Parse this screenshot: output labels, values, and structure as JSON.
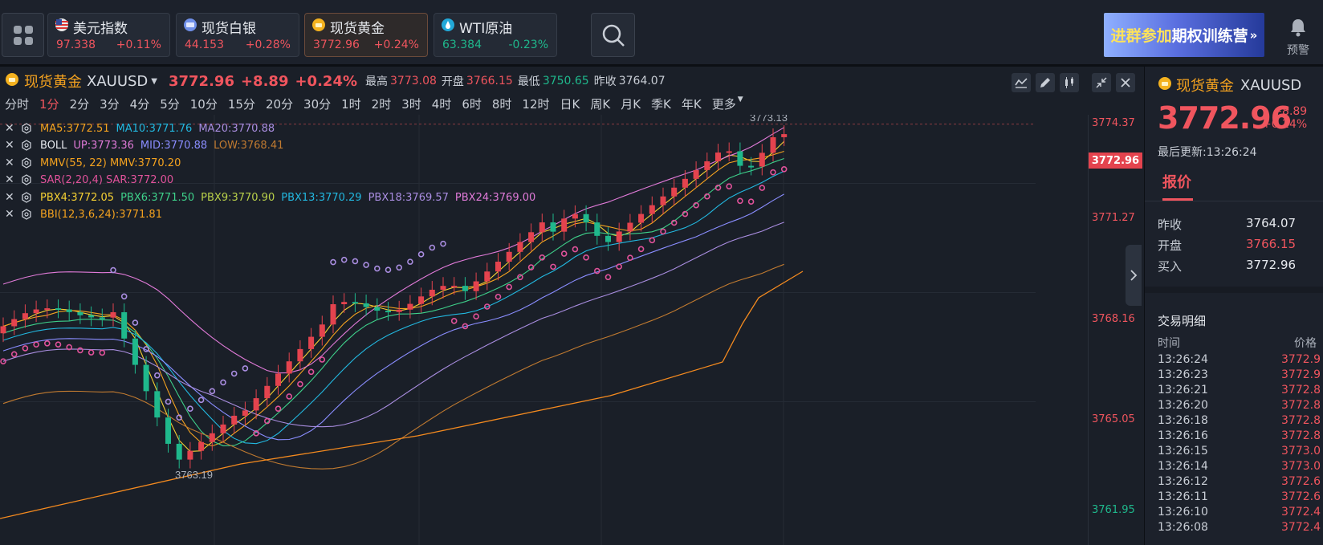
{
  "tickers": [
    {
      "name": "美元指数",
      "price": "97.338",
      "change": "+0.11%",
      "dir": "up",
      "icon": "us-flag-icon"
    },
    {
      "name": "现货白银",
      "price": "44.153",
      "change": "+0.28%",
      "dir": "up",
      "icon": "silver-coin-icon"
    },
    {
      "name": "现货黄金",
      "price": "3772.96",
      "change": "+0.24%",
      "dir": "up",
      "icon": "gold-coin-icon"
    },
    {
      "name": "WTI原油",
      "price": "63.384",
      "change": "-0.23%",
      "dir": "down",
      "icon": "oil-icon"
    }
  ],
  "banner": {
    "part1": "进群参加",
    "part2": "期权训练营",
    "arrow": "»"
  },
  "alarm": {
    "label": "预警"
  },
  "chart_header": {
    "name": "现货黄金",
    "symbol": "XAUUSD",
    "price": "3772.96",
    "change": "+8.89",
    "change_pct": "+0.24%",
    "high_label": "最高",
    "high": "3773.08",
    "open_label": "开盘",
    "open": "3766.15",
    "low_label": "最低",
    "low": "3750.65",
    "prev_label": "昨收",
    "prev": "3764.07"
  },
  "timeframes": [
    "分时",
    "1分",
    "2分",
    "3分",
    "4分",
    "5分",
    "10分",
    "15分",
    "20分",
    "30分",
    "1时",
    "2时",
    "3时",
    "4时",
    "6时",
    "8时",
    "12时",
    "日K",
    "周K",
    "月K",
    "季K",
    "年K",
    "更多"
  ],
  "active_timeframe": "1分",
  "indicators": [
    [
      {
        "t": "MA5:3772.51",
        "c": "#f4a21f"
      },
      {
        "t": "MA10:3771.76",
        "c": "#22b8e0"
      },
      {
        "t": "MA20:3770.88",
        "c": "#a98de0"
      }
    ],
    [
      {
        "t": "BOLL",
        "c": "#e6e9ee"
      },
      {
        "t": "UP:3773.36",
        "c": "#e07ad8"
      },
      {
        "t": "MID:3770.88",
        "c": "#8a8dff"
      },
      {
        "t": "LOW:3768.41",
        "c": "#c07a30"
      }
    ],
    [
      {
        "t": "MMV(55, 22) MMV:3770.20",
        "c": "#f4a21f"
      }
    ],
    [
      {
        "t": "SAR(2,20,4) SAR:3772.00",
        "c": "#e0529a"
      }
    ],
    [
      {
        "t": "PBX4:3772.05",
        "c": "#f5d033"
      },
      {
        "t": "PBX6:3771.50",
        "c": "#3ed08a"
      },
      {
        "t": "PBX9:3770.90",
        "c": "#b9d04a"
      },
      {
        "t": "PBX13:3770.29",
        "c": "#22b8e0"
      },
      {
        "t": "PBX18:3769.57",
        "c": "#a98de0"
      },
      {
        "t": "PBX24:3769.00",
        "c": "#e07ad8"
      }
    ],
    [
      {
        "t": "BBI(12,3,6,24):3771.81",
        "c": "#f4a21f"
      }
    ]
  ],
  "price_axis": [
    "3774.37",
    "3772.96",
    "3771.27",
    "3768.16",
    "3765.05",
    "3761.95"
  ],
  "annotations": {
    "high_mark": "3773.13",
    "low_mark": "3763.19"
  },
  "right_panel": {
    "name": "现货黄金",
    "symbol": "XAUUSD",
    "price": "3772.96",
    "change": "+8.89",
    "change_pct": "+0.24%",
    "updated": "最后更新:13:26:24",
    "tab": "报价",
    "quote": [
      {
        "label": "昨收",
        "value": "3764.07",
        "color": "#e6e9ee"
      },
      {
        "label": "开盘",
        "value": "3766.15",
        "color": "#f0555e"
      },
      {
        "label": "买入",
        "value": "3772.96",
        "color": "#e6e9ee"
      }
    ],
    "trades_title": "交易明细",
    "col_time": "时间",
    "col_price": "价格",
    "trades": [
      {
        "time": "13:26:24",
        "price": "3772.9"
      },
      {
        "time": "13:26:23",
        "price": "3772.9"
      },
      {
        "time": "13:26:21",
        "price": "3772.8"
      },
      {
        "time": "13:26:20",
        "price": "3772.8"
      },
      {
        "time": "13:26:18",
        "price": "3772.8"
      },
      {
        "time": "13:26:16",
        "price": "3772.8"
      },
      {
        "time": "13:26:15",
        "price": "3773.0"
      },
      {
        "time": "13:26:14",
        "price": "3773.0"
      },
      {
        "time": "13:26:12",
        "price": "3772.6"
      },
      {
        "time": "13:26:11",
        "price": "3772.6"
      },
      {
        "time": "13:26:10",
        "price": "3772.4"
      },
      {
        "time": "13:26:08",
        "price": "3772.4"
      }
    ]
  },
  "colors": {
    "up": "#f0555e",
    "down": "#1fb88c",
    "accent": "#f4a21f",
    "bg": "#1a1f28"
  }
}
